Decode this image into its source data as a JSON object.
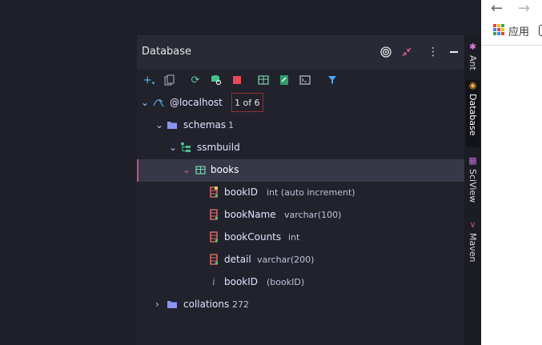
{
  "panel": {
    "title": "Database",
    "header_icons": [
      "target-icon",
      "collapse-icon",
      "more-icon",
      "minimize-icon"
    ]
  },
  "toolbar": {
    "icons": [
      "add-icon",
      "copy-icon",
      "refresh-icon",
      "schema-icon",
      "stop-icon",
      "table-icon",
      "edit-icon",
      "console-icon",
      "filter-icon"
    ]
  },
  "tree": {
    "host": {
      "label": "@localhost",
      "badge": "1 of 6"
    },
    "schemas": {
      "label": "schemas",
      "count": "1"
    },
    "db": {
      "label": "ssmbuild"
    },
    "table": {
      "label": "books"
    },
    "columns": [
      {
        "name": "bookID",
        "type": "int (auto increment)"
      },
      {
        "name": "bookName",
        "type": "varchar(100)"
      },
      {
        "name": "bookCounts",
        "type": "int"
      },
      {
        "name": "detail",
        "type": "varchar(200)"
      }
    ],
    "index": {
      "name": "bookID",
      "meta": "(bookID)"
    },
    "collations": {
      "label": "collations",
      "count": "272"
    }
  },
  "sidebar": {
    "tabs": [
      {
        "label": "Ant"
      },
      {
        "label": "Database"
      },
      {
        "label": "SciView"
      },
      {
        "label": "Maven"
      }
    ]
  },
  "browser": {
    "apps_label": "应用"
  },
  "colors": {
    "accent": "#d14a8a",
    "selection": "#363848",
    "badge_border": "#9b3030",
    "folder": "#8a95f0",
    "column_icon": "#e0706c"
  }
}
